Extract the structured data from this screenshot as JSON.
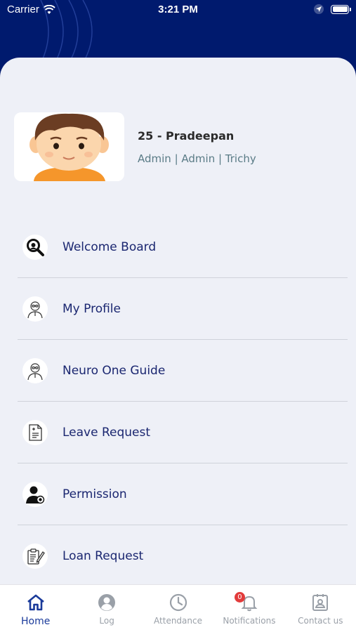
{
  "status_bar": {
    "carrier": "Carrier",
    "time": "3:21 PM"
  },
  "profile": {
    "name": "25 - Pradeepan",
    "role": "Admin | Admin | Trichy"
  },
  "menu": [
    {
      "label": "Welcome Board",
      "icon": "search-icon"
    },
    {
      "label": "My Profile",
      "icon": "user-outline-icon"
    },
    {
      "label": "Neuro One Guide",
      "icon": "user-outline-icon"
    },
    {
      "label": "Leave Request",
      "icon": "document-add-icon"
    },
    {
      "label": "Permission",
      "icon": "user-badge-icon"
    },
    {
      "label": "Loan Request",
      "icon": "clipboard-edit-icon"
    }
  ],
  "tabs": [
    {
      "label": "Home",
      "icon": "home-icon",
      "active": true
    },
    {
      "label": "Log",
      "icon": "user-circle-icon"
    },
    {
      "label": "Attendance",
      "icon": "clock-icon"
    },
    {
      "label": "Notifications",
      "icon": "bell-icon",
      "badge": "0"
    },
    {
      "label": "Contact us",
      "icon": "contact-card-icon"
    }
  ],
  "colors": {
    "header": "#001a6e",
    "panel": "#eef0f7",
    "accent": "#1a3a9a",
    "menu_text": "#1a2670",
    "badge": "#e23b3b"
  }
}
